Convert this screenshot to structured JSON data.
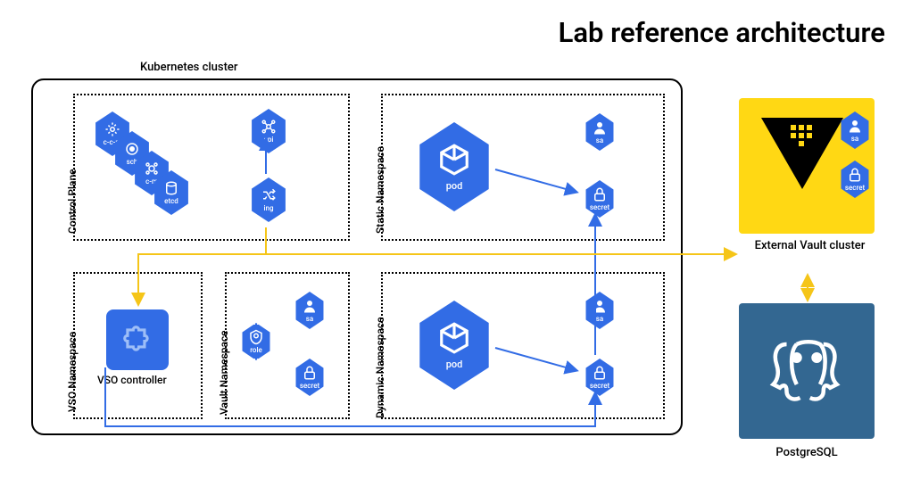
{
  "title": "Lab reference architecture",
  "cluster_label": "Kubernetes cluster",
  "namespaces": {
    "control_plane": {
      "label": "Control Plane",
      "components": [
        "c-c-m",
        "sch",
        "c-m",
        "etcd",
        "api",
        "ing"
      ]
    },
    "static": {
      "label": "Static Namespace",
      "components": [
        "pod",
        "sa",
        "secret"
      ]
    },
    "vso": {
      "label": "VSO Namespace",
      "controller_label": "VSO controller"
    },
    "vault": {
      "label": "Vault Namespace",
      "components": [
        "role",
        "sa",
        "secret"
      ]
    },
    "dynamic": {
      "label": "Dynamic Namespace",
      "components": [
        "pod",
        "sa",
        "secret"
      ]
    }
  },
  "external": {
    "vault": {
      "label": "External Vault cluster",
      "components": [
        "sa",
        "secret"
      ]
    },
    "postgres": {
      "label": "PostgreSQL"
    }
  },
  "arrows": [
    {
      "color": "blue",
      "desc": "ing -> api"
    },
    {
      "color": "blue",
      "desc": "static pod -> secret"
    },
    {
      "color": "blue",
      "desc": "dynamic pod -> secret"
    },
    {
      "color": "blue",
      "desc": "vso -> static secret"
    },
    {
      "color": "blue",
      "desc": "vso -> dynamic secret"
    },
    {
      "color": "yellow",
      "desc": "ing -> vso"
    },
    {
      "color": "yellow",
      "desc": "vso -> external vault"
    },
    {
      "color": "yellow",
      "desc": "external vault <-> postgres"
    }
  ]
}
